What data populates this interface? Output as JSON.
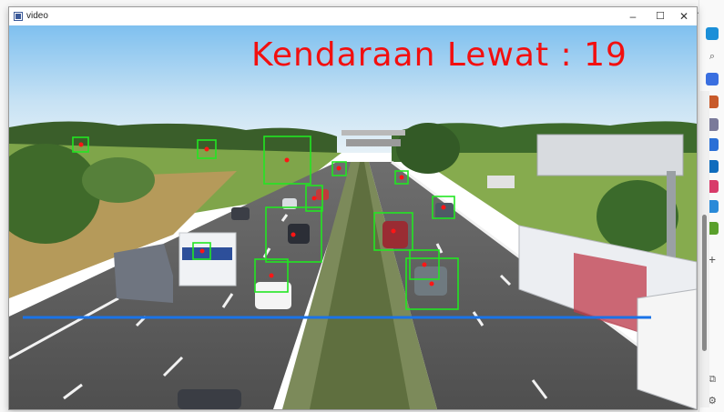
{
  "window": {
    "title": "video",
    "controls": {
      "minimize": "–",
      "maximize": "☐",
      "close": "✕"
    }
  },
  "overlay": {
    "vehicle_count_label": "Kendaraan Lewat : 19"
  },
  "background": {
    "menu_glyph": "...",
    "close_glyph": "×",
    "plus_glyph": "+"
  },
  "colors": {
    "count_text": "#f20f0f",
    "detection_box": "#22e622",
    "detection_center": "#ff1515",
    "counting_line": "#1a73e8"
  }
}
